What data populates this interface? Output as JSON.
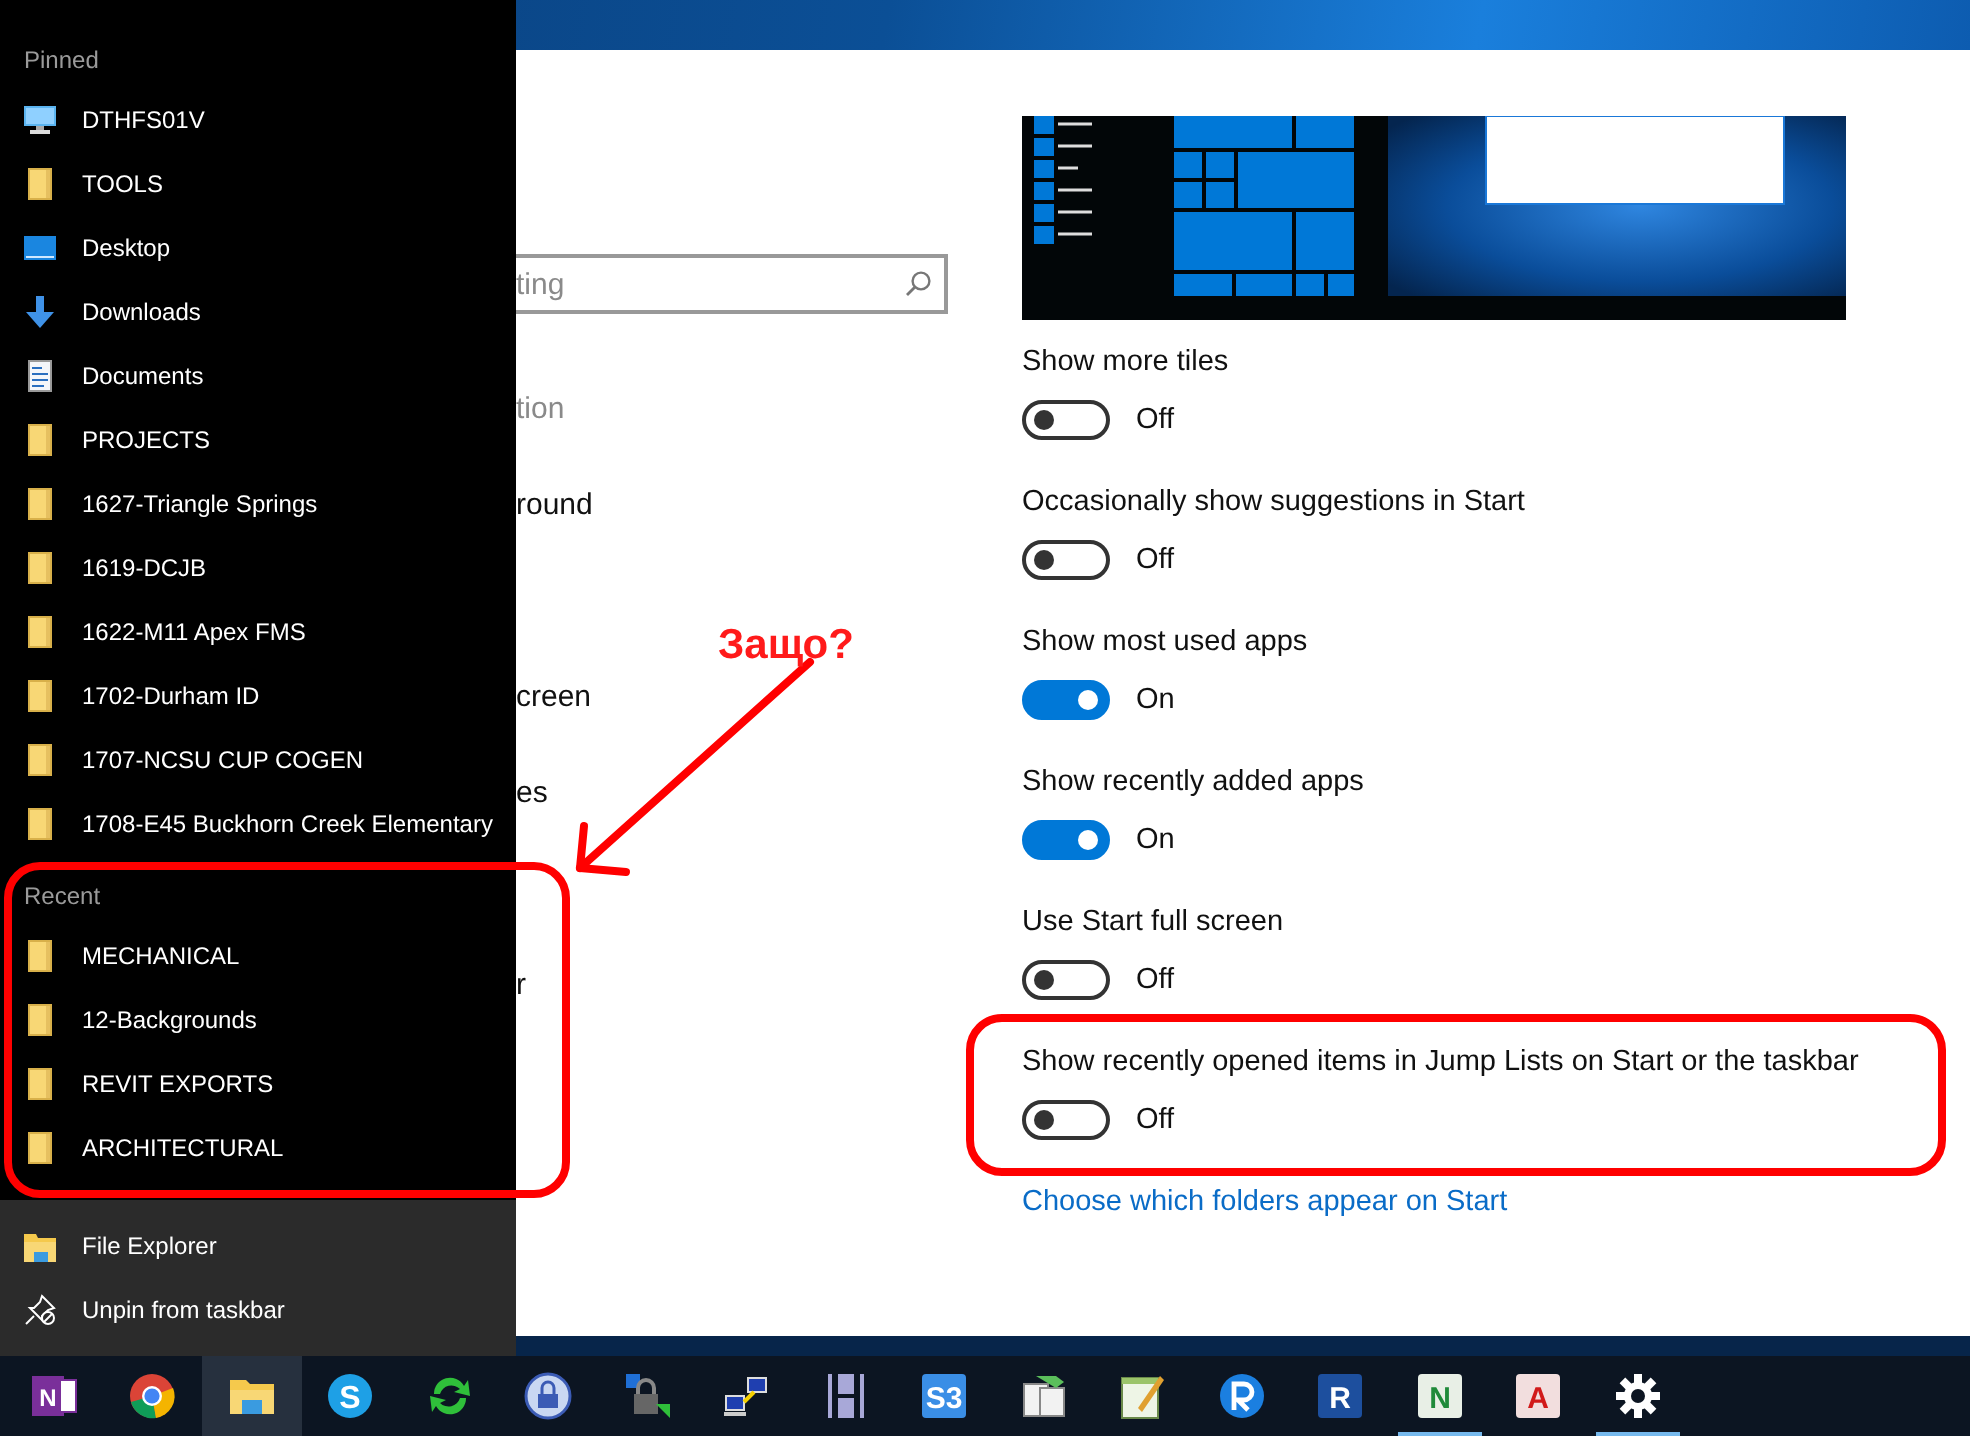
{
  "jump_list": {
    "sections": [
      {
        "header": "Pinned",
        "items": [
          {
            "label": "DTHFS01V",
            "kind": "computer"
          },
          {
            "label": "TOOLS",
            "kind": "folder"
          },
          {
            "label": "Desktop",
            "kind": "desktop"
          },
          {
            "label": "Downloads",
            "kind": "download"
          },
          {
            "label": "Documents",
            "kind": "document"
          },
          {
            "label": "PROJECTS",
            "kind": "folder"
          },
          {
            "label": "1627-Triangle Springs",
            "kind": "folder"
          },
          {
            "label": "1619-DCJB",
            "kind": "folder"
          },
          {
            "label": "1622-M11 Apex FMS",
            "kind": "folder"
          },
          {
            "label": "1702-Durham ID",
            "kind": "folder"
          },
          {
            "label": "1707-NCSU CUP COGEN",
            "kind": "folder"
          },
          {
            "label": "1708-E45 Buckhorn Creek Elementary",
            "kind": "folder"
          }
        ]
      },
      {
        "header": "Recent",
        "items": [
          {
            "label": "MECHANICAL",
            "kind": "folder"
          },
          {
            "label": "12-Backgrounds",
            "kind": "folder"
          },
          {
            "label": "REVIT EXPORTS",
            "kind": "folder"
          },
          {
            "label": "ARCHITECTURAL",
            "kind": "folder"
          }
        ]
      }
    ],
    "actions": [
      {
        "label": "File Explorer",
        "kind": "explorer"
      },
      {
        "label": "Unpin from taskbar",
        "kind": "unpin"
      }
    ]
  },
  "settings": {
    "search": {
      "placeholder": "ting"
    },
    "nav": [
      {
        "label": "tion",
        "kind": "heading"
      },
      {
        "label": "round",
        "kind": "link"
      },
      {
        "label": "creen",
        "kind": "link"
      },
      {
        "label": "es",
        "kind": "link"
      },
      {
        "label": "r",
        "kind": "link"
      }
    ],
    "options": [
      {
        "label": "Show more tiles",
        "on": false,
        "state_text": "Off"
      },
      {
        "label": "Occasionally show suggestions in Start",
        "on": false,
        "state_text": "Off"
      },
      {
        "label": "Show most used apps",
        "on": true,
        "state_text": "On"
      },
      {
        "label": "Show recently added apps",
        "on": true,
        "state_text": "On"
      },
      {
        "label": "Use Start full screen",
        "on": false,
        "state_text": "Off"
      },
      {
        "label": "Show recently opened items in Jump Lists on Start or the taskbar",
        "on": false,
        "state_text": "Off"
      }
    ],
    "link": "Choose which folders appear on Start"
  },
  "annotation": {
    "note": "Защо?"
  },
  "taskbar": {
    "items": [
      {
        "kind": "onenote",
        "glyph": "N",
        "selected": false,
        "running": false
      },
      {
        "kind": "chrome",
        "selected": false,
        "running": false
      },
      {
        "kind": "explorer",
        "selected": true,
        "running": false
      },
      {
        "kind": "skype",
        "glyph": "S",
        "selected": false,
        "running": false
      },
      {
        "kind": "sync",
        "selected": false,
        "running": false
      },
      {
        "kind": "lock",
        "selected": false,
        "running": false
      },
      {
        "kind": "locknet",
        "selected": false,
        "running": false
      },
      {
        "kind": "network",
        "selected": false,
        "running": false
      },
      {
        "kind": "bars",
        "selected": false,
        "running": false
      },
      {
        "kind": "tile",
        "glyph": "S3",
        "color": "#3a8ee6",
        "selected": false,
        "running": false
      },
      {
        "kind": "ab",
        "selected": false,
        "running": false
      },
      {
        "kind": "notepad",
        "selected": false,
        "running": false
      },
      {
        "kind": "ring",
        "selected": false,
        "running": false
      },
      {
        "kind": "tile",
        "glyph": "R",
        "color": "#1d4f9e",
        "selected": false,
        "running": false
      },
      {
        "kind": "tile",
        "glyph": "N",
        "color": "#e8efe6",
        "selected": false,
        "running": true
      },
      {
        "kind": "tile",
        "glyph": "A",
        "color": "#f2dede",
        "selected": false,
        "running": false
      },
      {
        "kind": "gear",
        "selected": false,
        "running": true
      }
    ]
  }
}
